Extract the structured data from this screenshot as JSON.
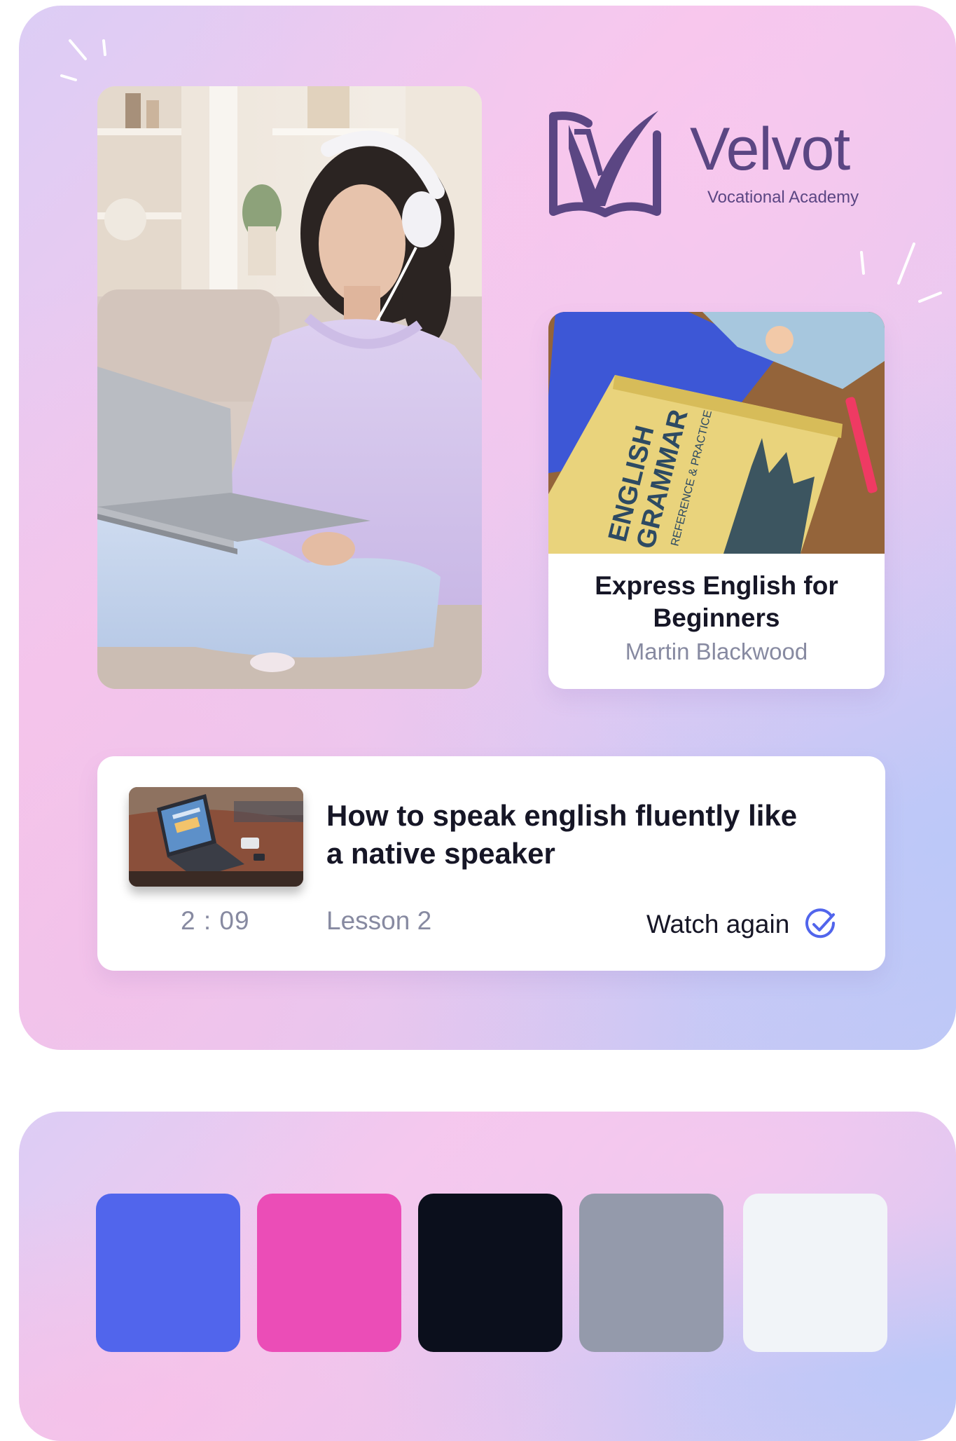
{
  "brand": {
    "name": "Velvot",
    "tagline": "Vocational Academy",
    "logo_color": "#5b4683"
  },
  "hero_photo": {
    "icon": "student-laptop-photo"
  },
  "course_card": {
    "title": "Express English for Beginners",
    "author": "Martin Blackwood",
    "book_cover": {
      "title_line1": "ENGLISH",
      "title_line2": "GRAMMAR",
      "subtitle": "REFERENCE & PRACTICE"
    }
  },
  "lesson_card": {
    "title": "How to speak english fluently like a native speaker",
    "duration": "2 : 09",
    "lesson_label": "Lesson 2",
    "action_label": "Watch again",
    "action_icon": "check-circle-icon",
    "accent_color": "#5165ec"
  },
  "palette": {
    "swatches": [
      {
        "color": "#5165ec"
      },
      {
        "color": "#eb4db7"
      },
      {
        "color": "#0b0f1c"
      },
      {
        "color": "#949aab"
      },
      {
        "color": "#f1f4f8"
      }
    ]
  }
}
